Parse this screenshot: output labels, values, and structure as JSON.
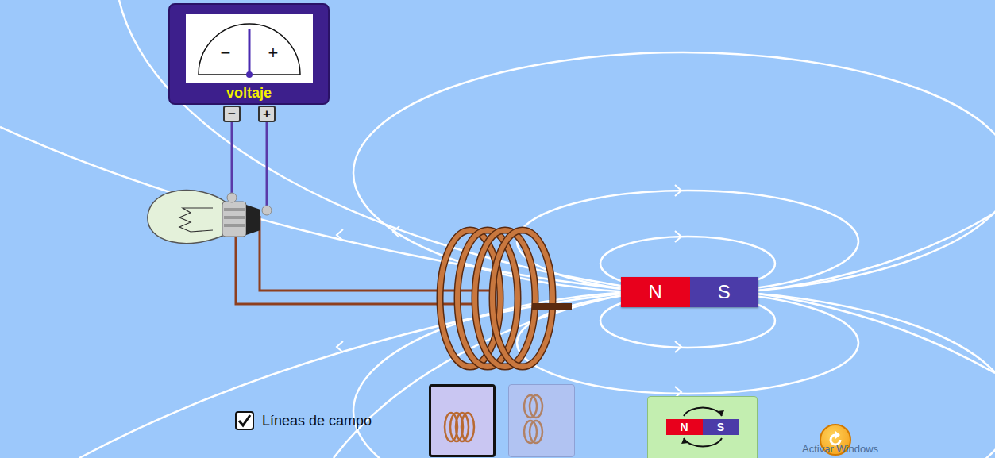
{
  "meter": {
    "title": "voltaje",
    "scale": [
      "−",
      "+"
    ],
    "terminals": [
      "−",
      "+"
    ],
    "level": 0.5
  },
  "bulb": {
    "lit": false
  },
  "magnet": {
    "north": "N",
    "south": "S"
  },
  "field_lines": {
    "label": "Líneas de campo",
    "checked": true
  },
  "coils": [
    {
      "kind": "single",
      "loops": 4,
      "selected": true
    },
    {
      "kind": "double",
      "loops": 2,
      "selected": false
    }
  ],
  "flip_button": {
    "north": "N",
    "south": "S"
  },
  "watermark": "Activar Windows"
}
